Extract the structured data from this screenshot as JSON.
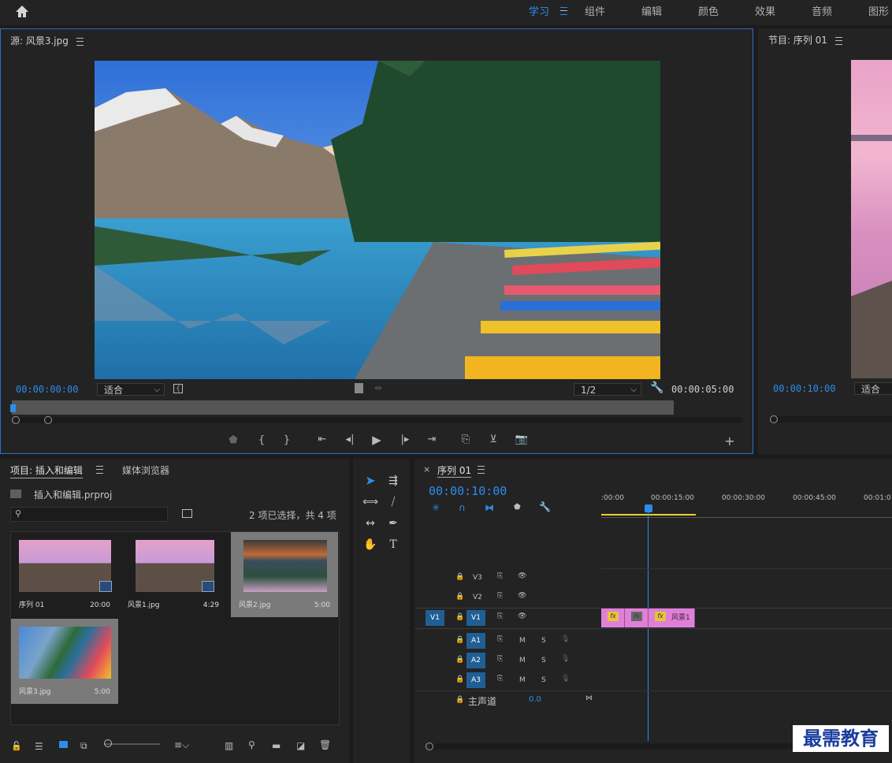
{
  "topbar": {
    "tabs": [
      "学习",
      "组件",
      "编辑",
      "颜色",
      "效果",
      "音频",
      "图形"
    ],
    "active_tab": "学习"
  },
  "source": {
    "title": "源: 风景3.jpg",
    "timecode_in": "00:00:00:00",
    "fit": "适合",
    "resolution": "1/2",
    "timecode_dur": "00:00:05:00"
  },
  "program": {
    "title": "节目: 序列 01",
    "timecode": "00:00:10:00",
    "fit": "适合"
  },
  "project": {
    "tab_active": "项目: 插入和编辑",
    "tab_other": "媒体浏览器",
    "file": "插入和编辑.prproj",
    "selection": "2 项已选择，共 4 项",
    "search_placeholder": "",
    "items": [
      {
        "name": "序列 01",
        "duration": "20:00"
      },
      {
        "name": "风景1.jpg",
        "duration": "4:29"
      },
      {
        "name": "风景2.jpg",
        "duration": "5:00"
      },
      {
        "name": "风景3.jpg",
        "duration": "5:00"
      }
    ]
  },
  "timeline": {
    "tab": "序列 01",
    "timecode": "00:00:10:00",
    "ruler": [
      ":00:00",
      "00:00:15:00",
      "00:00:30:00",
      "00:00:45:00",
      "00:01:0"
    ],
    "video_tracks": [
      "V3",
      "V2",
      "V1"
    ],
    "audio_tracks": [
      "A1",
      "A2",
      "A3"
    ],
    "master_label": "主声道",
    "master_value": "0.0",
    "source_patch": "V1",
    "clip_label": "风景1",
    "fx_label": "fx",
    "mute_label": "M",
    "solo_label": "S"
  },
  "watermark": "最需教育",
  "colors": {
    "accent": "#2d8ceb",
    "clip": "#e07fd8",
    "selected_tile": "#7a7a7a"
  }
}
